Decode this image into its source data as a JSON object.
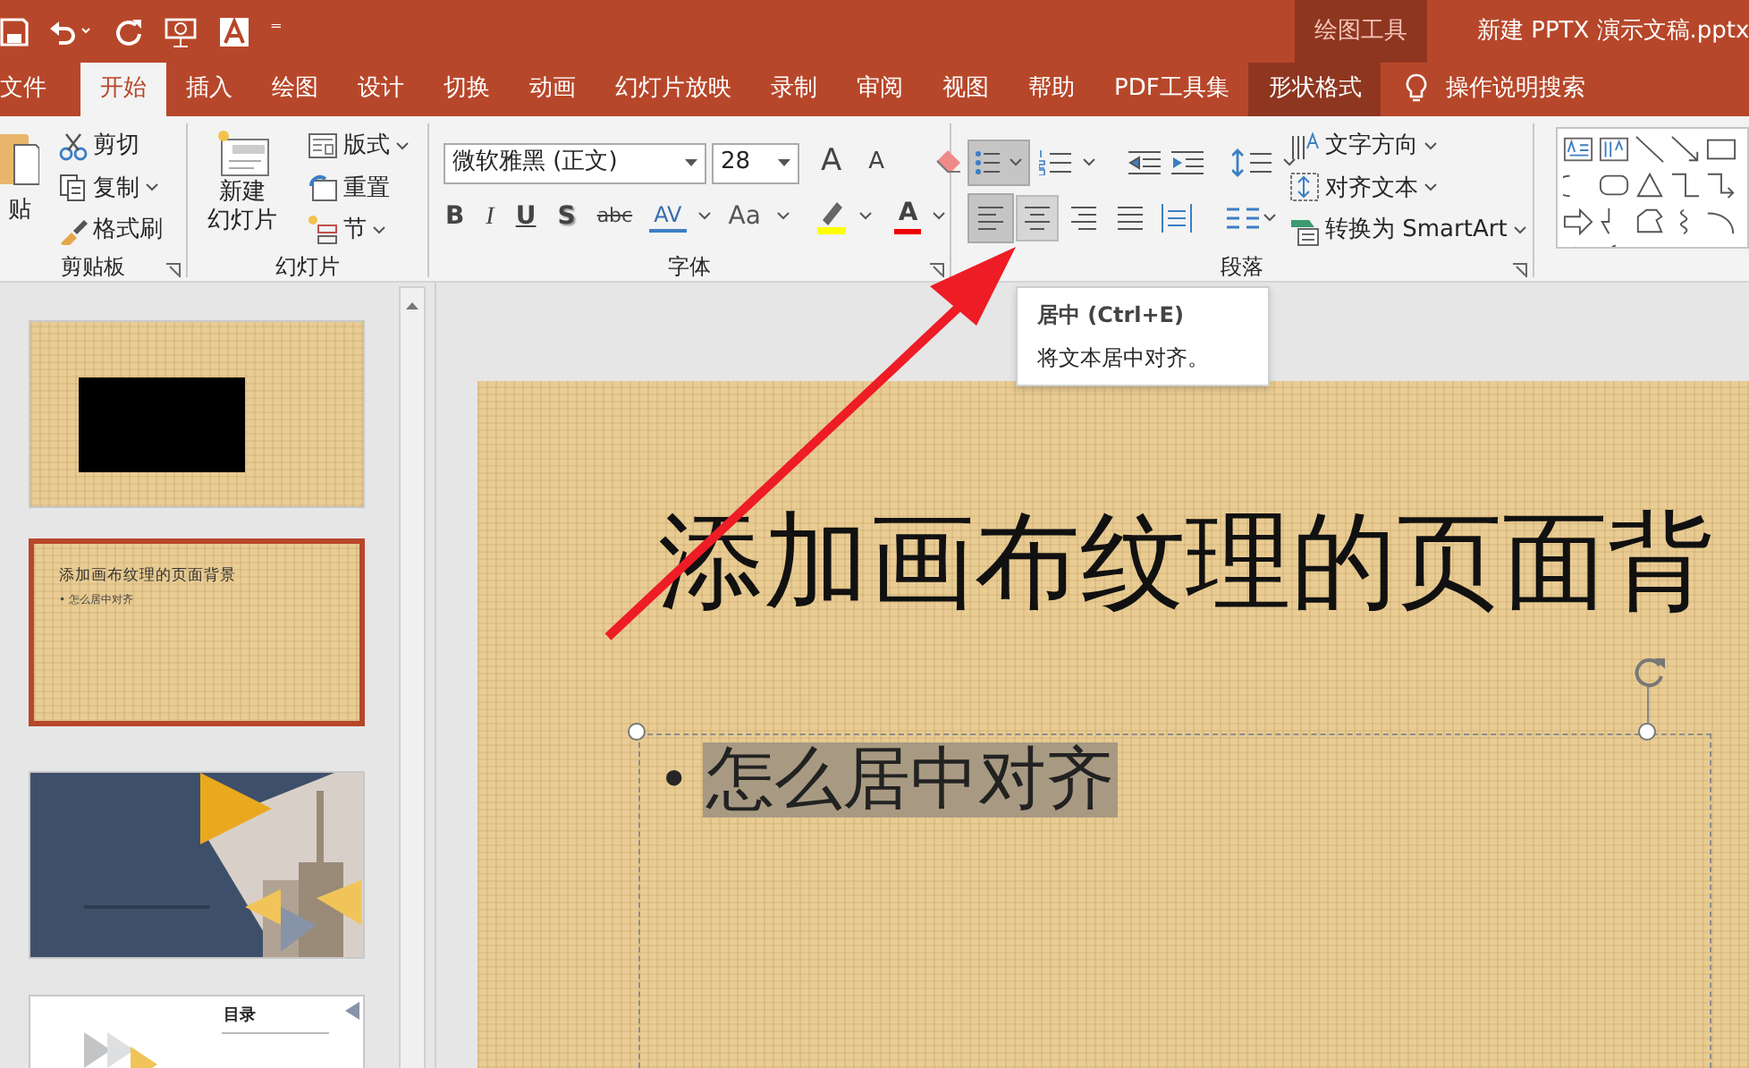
{
  "title_bar": {
    "context_label": "绘图工具",
    "document_title": "新建 PPTX 演示文稿.pptx",
    "customize": "⁼"
  },
  "tabs": [
    {
      "label": "文件",
      "selected": false,
      "kind": "normal"
    },
    {
      "label": "开始",
      "selected": true,
      "kind": "normal"
    },
    {
      "label": "插入",
      "selected": false,
      "kind": "normal"
    },
    {
      "label": "绘图",
      "selected": false,
      "kind": "normal"
    },
    {
      "label": "设计",
      "selected": false,
      "kind": "normal"
    },
    {
      "label": "切换",
      "selected": false,
      "kind": "normal"
    },
    {
      "label": "动画",
      "selected": false,
      "kind": "normal"
    },
    {
      "label": "幻灯片放映",
      "selected": false,
      "kind": "normal"
    },
    {
      "label": "录制",
      "selected": false,
      "kind": "normal"
    },
    {
      "label": "审阅",
      "selected": false,
      "kind": "normal"
    },
    {
      "label": "视图",
      "selected": false,
      "kind": "normal"
    },
    {
      "label": "帮助",
      "selected": false,
      "kind": "normal"
    },
    {
      "label": "PDF工具集",
      "selected": false,
      "kind": "normal"
    },
    {
      "label": "形状格式",
      "selected": false,
      "kind": "contextual"
    }
  ],
  "search": {
    "label": "操作说明搜索"
  },
  "clipboard": {
    "paste": "贴",
    "buttons": [
      "剪切",
      "复制",
      "格式刷"
    ],
    "label": "剪贴板"
  },
  "slides_group": {
    "new_slide": [
      "新建",
      "幻灯片"
    ],
    "buttons": [
      "版式",
      "重置",
      "节"
    ],
    "label": "幻灯片"
  },
  "font": {
    "font_name": "微软雅黑 (正文)",
    "font_size": "28",
    "size_buttons": [
      {
        "text": "A",
        "kind": "grow"
      },
      {
        "text": "A",
        "kind": "shrink"
      }
    ],
    "format_buttons": [
      {
        "text": "B",
        "kind": "bold"
      },
      {
        "text": "I",
        "kind": "italic"
      },
      {
        "text": "U",
        "kind": "underline"
      },
      {
        "text": "S",
        "kind": "shadow"
      },
      {
        "text": "abc",
        "kind": "strike"
      },
      {
        "text": "AV",
        "kind": "spacing"
      },
      {
        "text": "Aa",
        "kind": "case"
      }
    ],
    "color_button": "A",
    "label": "字体"
  },
  "paragraph": {
    "bullets_selected": true,
    "alignment": [
      {
        "selected": true,
        "hovered": false
      },
      {
        "selected": false,
        "hovered": true
      },
      {
        "selected": false,
        "hovered": false
      },
      {
        "selected": false,
        "hovered": false
      },
      {
        "selected": false,
        "hovered": false
      }
    ],
    "buttons": [
      "文字方向",
      "对齐文本",
      "转换为 SmartArt"
    ],
    "label": "段落"
  },
  "tooltip": {
    "title": "居中 (Ctrl+E)",
    "text": "将文本居中对齐。"
  },
  "slides": [
    {
      "kind": "video",
      "selected": false
    },
    {
      "kind": "text",
      "title": "添加画布纹理的页面背景",
      "bullet": "• 怎么居中对齐",
      "selected": true
    },
    {
      "kind": "picture",
      "selected": false
    },
    {
      "kind": "toc",
      "title": "目录",
      "selected": false
    }
  ],
  "slide": {
    "title": "添加画布纹理的页面背",
    "bullet": "•",
    "body": "怎么居中对齐"
  }
}
